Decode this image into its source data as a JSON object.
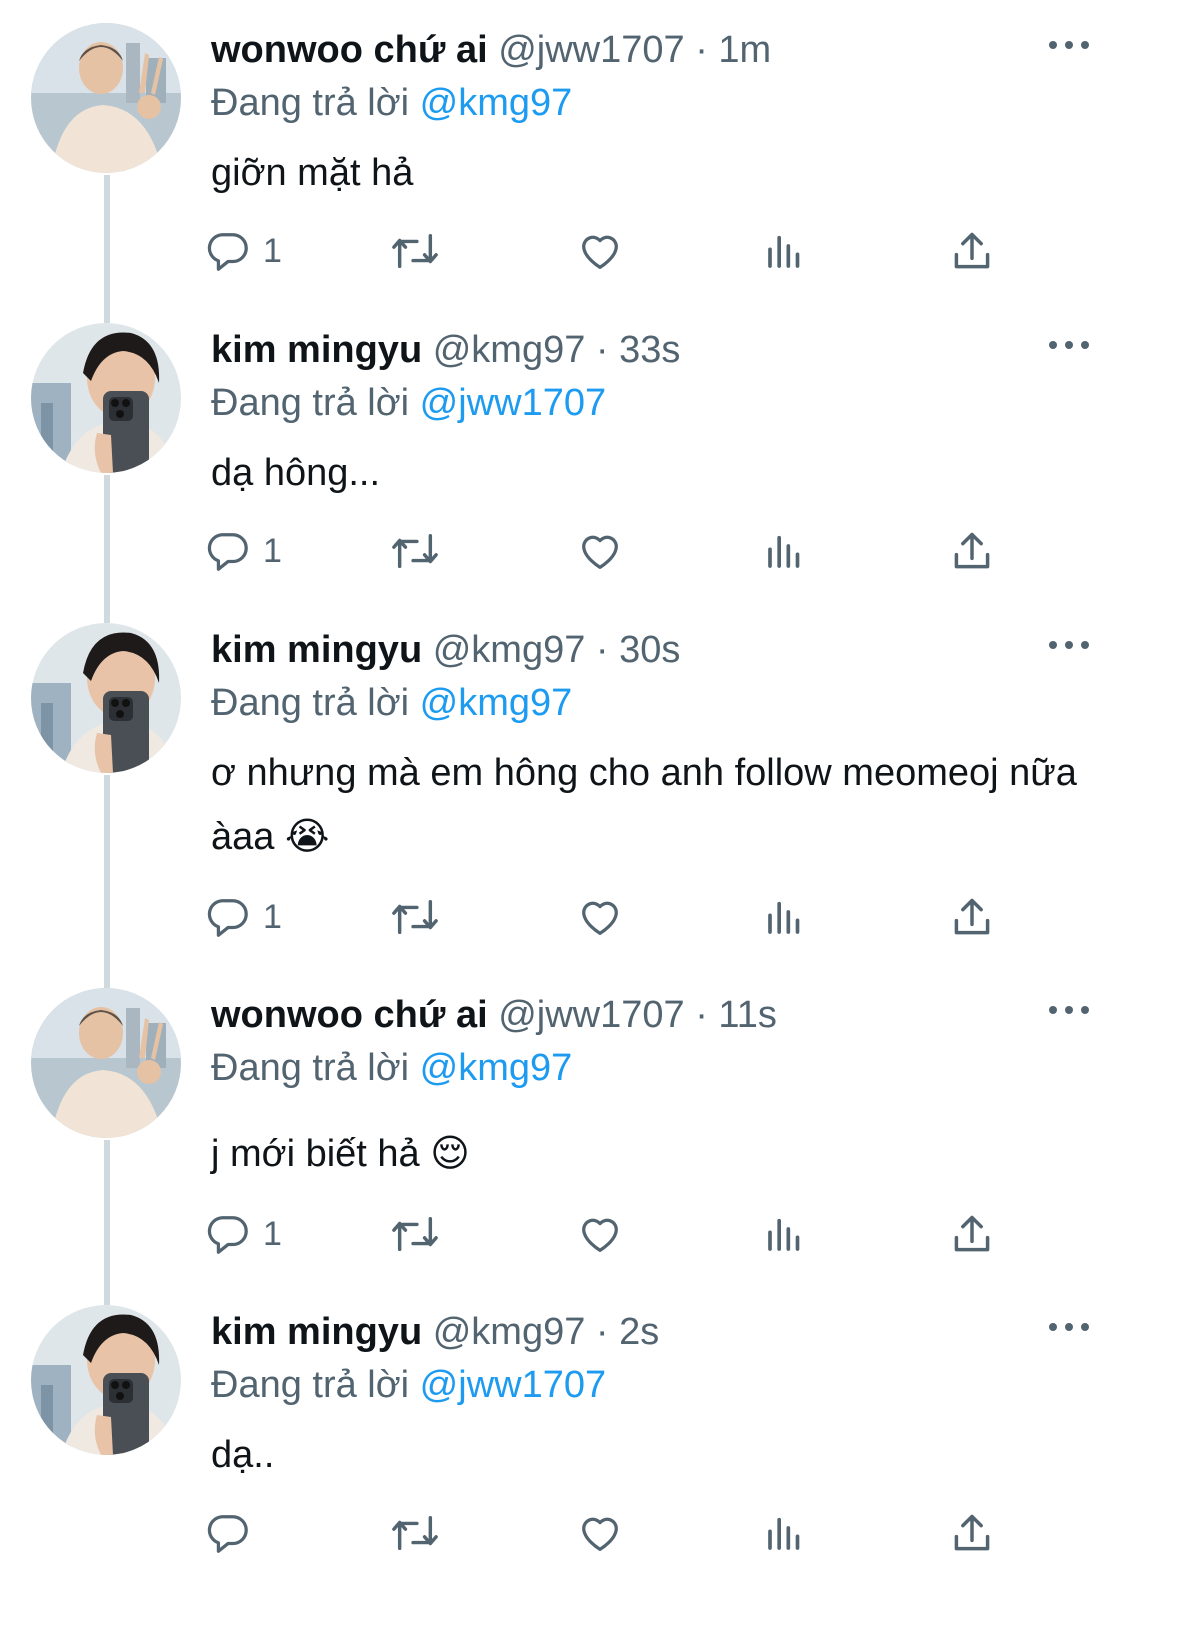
{
  "colors": {
    "text": "#0f1419",
    "secondary": "#536471",
    "link": "#1d9bf0",
    "thread_line": "#cfd9de",
    "background": "#ffffff"
  },
  "icons": {
    "reply": "reply-icon",
    "retweet": "retweet-icon",
    "like": "like-icon",
    "views": "views-icon",
    "share": "share-icon",
    "more": "more-icon"
  },
  "tweets": [
    {
      "display_name": "wonwoo chứ ai",
      "handle": "@jww1707",
      "separator": "·",
      "time": "1m",
      "replying_prefix": "Đang trả lời",
      "replying_to": "@kmg97",
      "text": "giỡn mặt hả",
      "reply_count": "1"
    },
    {
      "display_name": "kim mingyu",
      "handle": "@kmg97",
      "separator": "·",
      "time": "33s",
      "replying_prefix": "Đang trả lời",
      "replying_to": "@jww1707",
      "text": "dạ hông...",
      "reply_count": "1"
    },
    {
      "display_name": "kim mingyu",
      "handle": "@kmg97",
      "separator": "·",
      "time": "30s",
      "replying_prefix": "Đang trả lời",
      "replying_to": "@kmg97",
      "text": "ơ nhưng mà em hông cho anh follow meomeoj nữa àaa 😭",
      "reply_count": "1"
    },
    {
      "display_name": "wonwoo chứ ai",
      "handle": "@jww1707",
      "separator": "·",
      "time": "11s",
      "replying_prefix": "Đang trả lời",
      "replying_to": "@kmg97",
      "text": "j mới biết hả 😌",
      "reply_count": "1"
    },
    {
      "display_name": "kim mingyu",
      "handle": "@kmg97",
      "separator": "·",
      "time": "2s",
      "replying_prefix": "Đang trả lời",
      "replying_to": "@jww1707",
      "text": "dạ..",
      "reply_count": ""
    }
  ]
}
